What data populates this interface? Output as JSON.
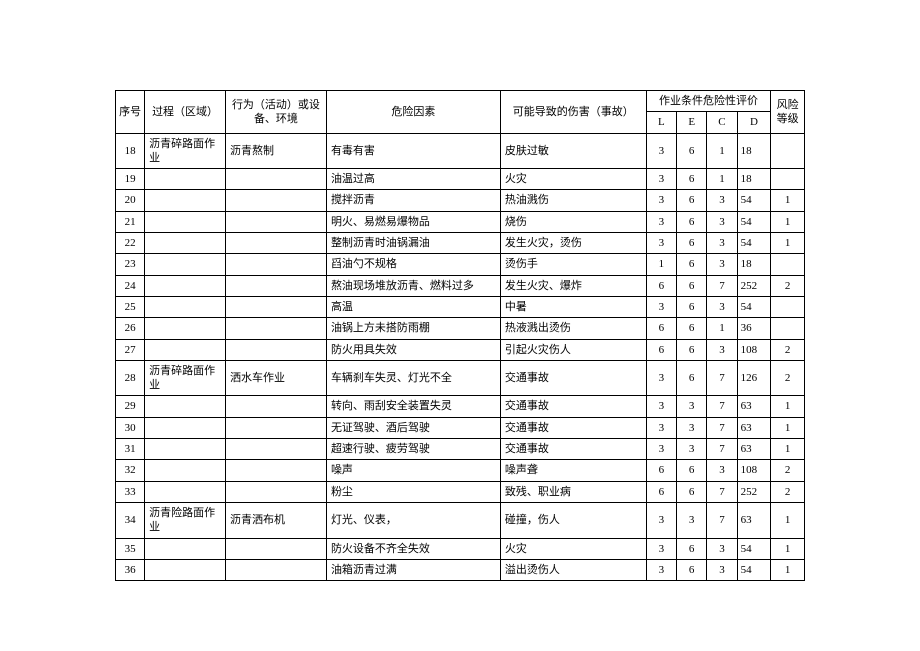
{
  "headers": {
    "seq": "序号",
    "process": "过程（区域）",
    "activity": "行为（活动）或设备、环境",
    "riskFactor": "危险因素",
    "possibleHarm": "可能导致的伤害（事故）",
    "evalGroup": "作业条件危险性评价",
    "L": "L",
    "E": "E",
    "C": "C",
    "D": "D",
    "level": "风险等级"
  },
  "rows": [
    {
      "seq": "18",
      "process": "沥青碎路面作业",
      "activity": "沥青熬制",
      "riskFactor": "有毒有害",
      "possibleHarm": "皮肤过敏",
      "L": "3",
      "E": "6",
      "C": "1",
      "D": "18",
      "level": ""
    },
    {
      "seq": "19",
      "process": "",
      "activity": "",
      "riskFactor": "油温过高",
      "possibleHarm": "火灾",
      "L": "3",
      "E": "6",
      "C": "1",
      "D": "18",
      "level": ""
    },
    {
      "seq": "20",
      "process": "",
      "activity": "",
      "riskFactor": "搅拌沥青",
      "possibleHarm": "热油溅伤",
      "L": "3",
      "E": "6",
      "C": "3",
      "D": "54",
      "level": "1"
    },
    {
      "seq": "21",
      "process": "",
      "activity": "",
      "riskFactor": "明火、易燃易爆物品",
      "possibleHarm": "烧伤",
      "L": "3",
      "E": "6",
      "C": "3",
      "D": "54",
      "level": "1"
    },
    {
      "seq": "22",
      "process": "",
      "activity": "",
      "riskFactor": "整制沥青时油锅漏油",
      "possibleHarm": "发生火灾，烫伤",
      "L": "3",
      "E": "6",
      "C": "3",
      "D": "54",
      "level": "1"
    },
    {
      "seq": "23",
      "process": "",
      "activity": "",
      "riskFactor": "舀油勺不规格",
      "possibleHarm": "烫伤手",
      "L": "1",
      "E": "6",
      "C": "3",
      "D": "18",
      "level": ""
    },
    {
      "seq": "24",
      "process": "",
      "activity": "",
      "riskFactor": "熬油现场堆放沥青、燃料过多",
      "possibleHarm": "发生火灾、爆炸",
      "L": "6",
      "E": "6",
      "C": "7",
      "D": "252",
      "level": "2"
    },
    {
      "seq": "25",
      "process": "",
      "activity": "",
      "riskFactor": "高温",
      "possibleHarm": "中暑",
      "L": "3",
      "E": "6",
      "C": "3",
      "D": "54",
      "level": ""
    },
    {
      "seq": "26",
      "process": "",
      "activity": "",
      "riskFactor": "油锅上方未搭防雨棚",
      "possibleHarm": "热液溅出烫伤",
      "L": "6",
      "E": "6",
      "C": "1",
      "D": "36",
      "level": ""
    },
    {
      "seq": "27",
      "process": "",
      "activity": "",
      "riskFactor": "防火用具失效",
      "possibleHarm": "引起火灾伤人",
      "L": "6",
      "E": "6",
      "C": "3",
      "D": "108",
      "level": "2"
    },
    {
      "seq": "28",
      "process": "沥青碎路面作业",
      "activity": "洒水车作业",
      "riskFactor": "车辆刹车失灵、灯光不全",
      "possibleHarm": "交通事故",
      "L": "3",
      "E": "6",
      "C": "7",
      "D": "126",
      "level": "2"
    },
    {
      "seq": "29",
      "process": "",
      "activity": "",
      "riskFactor": "转向、雨刮安全装置失灵",
      "possibleHarm": "交通事故",
      "L": "3",
      "E": "3",
      "C": "7",
      "D": "63",
      "level": "1"
    },
    {
      "seq": "30",
      "process": "",
      "activity": "",
      "riskFactor": "无证驾驶、酒后驾驶",
      "possibleHarm": "交通事故",
      "L": "3",
      "E": "3",
      "C": "7",
      "D": "63",
      "level": "1"
    },
    {
      "seq": "31",
      "process": "",
      "activity": "",
      "riskFactor": "超速行驶、疲劳驾驶",
      "possibleHarm": "交通事故",
      "L": "3",
      "E": "3",
      "C": "7",
      "D": "63",
      "level": "1"
    },
    {
      "seq": "32",
      "process": "",
      "activity": "",
      "riskFactor": "噪声",
      "possibleHarm": "噪声聋",
      "L": "6",
      "E": "6",
      "C": "3",
      "D": "108",
      "level": "2"
    },
    {
      "seq": "33",
      "process": "",
      "activity": "",
      "riskFactor": "粉尘",
      "possibleHarm": "致残、职业病",
      "L": "6",
      "E": "6",
      "C": "7",
      "D": "252",
      "level": "2"
    },
    {
      "seq": "34",
      "process": "沥青险路面作业",
      "activity": "沥青洒布机",
      "riskFactor": "灯光、仪表，",
      "possibleHarm": "碰撞，伤人",
      "L": "3",
      "E": "3",
      "C": "7",
      "D": "63",
      "level": "1"
    },
    {
      "seq": "35",
      "process": "",
      "activity": "",
      "riskFactor": "防火设备不齐全失效",
      "possibleHarm": "火灾",
      "L": "3",
      "E": "6",
      "C": "3",
      "D": "54",
      "level": "1"
    },
    {
      "seq": "36",
      "process": "",
      "activity": "",
      "riskFactor": "油箱沥青过满",
      "possibleHarm": "溢出烫伤人",
      "L": "3",
      "E": "6",
      "C": "3",
      "D": "54",
      "level": "1"
    }
  ]
}
